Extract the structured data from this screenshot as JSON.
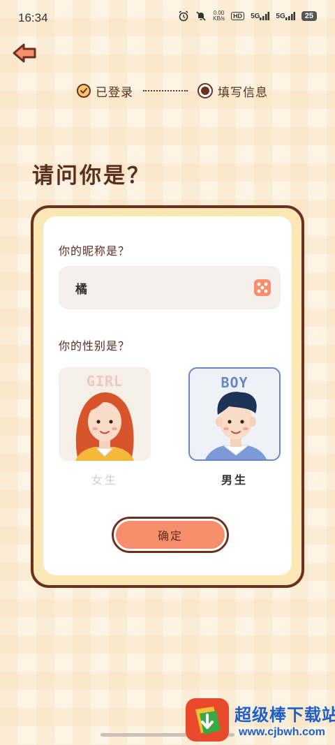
{
  "status_bar": {
    "time": "16:34",
    "speed_value": "0.00",
    "speed_unit": "KB/s",
    "hd_label": "HD",
    "net1": "5G",
    "net2": "5G",
    "battery": "25"
  },
  "nav": {
    "back_icon": "back-arrow-icon"
  },
  "steps": {
    "done_label": "已登录",
    "current_label": "填写信息"
  },
  "page": {
    "title": "请问你是？"
  },
  "form": {
    "nickname_question": "你的昵称是？",
    "nickname_value": "橘",
    "random_icon": "dice-icon",
    "gender_question": "你的性别是？",
    "genders": [
      {
        "tag": "GIRL",
        "label": "女生",
        "selected": false
      },
      {
        "tag": "BOY",
        "label": "男生",
        "selected": true
      }
    ],
    "confirm_label": "确定"
  },
  "watermark": {
    "title": "超级棒下载站",
    "url": "www.cjbwh.com"
  },
  "colors": {
    "brown": "#6b3120",
    "accent": "#f98e6c",
    "card_frame": "#fbe8b4",
    "boy_border": "#6b86c4"
  }
}
